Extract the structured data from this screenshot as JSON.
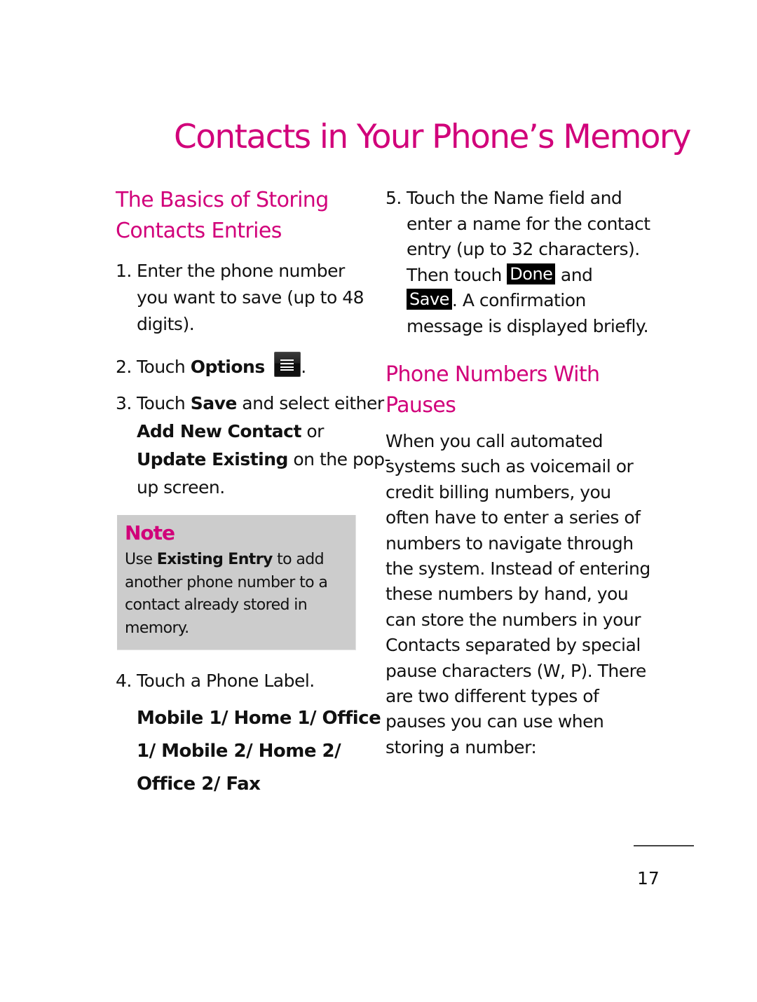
{
  "page_title": "Contacts in Your Phone’s Memory",
  "section1": {
    "heading_line1": "The Basics of Storing",
    "heading_line2": "Contacts Entries",
    "step1": {
      "number": "1.",
      "line1": "Enter the phone number",
      "line2": "you want to save (up to 48",
      "line3": "digits)."
    },
    "step2": {
      "number": "2.",
      "prefix": "Touch ",
      "bold": "Options",
      "suffix": ".",
      "icon": "options-menu-icon"
    },
    "step3": {
      "number": "3.",
      "prefix": "Touch ",
      "bold_save": "Save",
      "mid": " and select either",
      "bold_add": "Add New Contact",
      "or": " or",
      "bold_update": "Update Existing",
      "tail": " on the pop-",
      "line_last": "up screen."
    },
    "note": {
      "title": "Note",
      "prefix": "Use ",
      "bold": "Existing Entry",
      "line1_tail": " to add",
      "line2": "another phone number to a",
      "line3": "contact already stored in",
      "line4": "memory."
    },
    "step4": {
      "number": "4.",
      "text": "Touch a Phone Label.",
      "labels_line1": "Mobile 1/ Home 1/ Office",
      "labels_line2": "1/ Mobile 2/ Home 2/",
      "labels_line3": "Office 2/ Fax"
    }
  },
  "section2": {
    "step5": {
      "number": "5.",
      "line1": "Touch the Name field and",
      "line2": "enter a name for the contact",
      "line3": "entry (up to 32 characters).",
      "line4_prefix": "Then touch ",
      "done_chip": "Done",
      "line4_suffix": " and",
      "save_chip": "Save",
      "line5_suffix": ". A confirmation",
      "line6": "message is displayed briefly."
    },
    "heading_line1": "Phone Numbers With",
    "heading_line2": "Pauses",
    "paragraph_lines": [
      "When you call automated",
      "systems such as voicemail or",
      "credit billing numbers, you",
      "often have to enter a series of",
      "numbers to navigate through",
      "the system. Instead of entering",
      "these numbers by hand, you",
      "can store the numbers in your",
      "Contacts separated by special",
      "pause characters (W, P). There",
      "are two different types of",
      "pauses you can use when",
      "storing a number:"
    ]
  },
  "footer": {
    "page_number": "17"
  },
  "colors": {
    "accent": "#d1007a",
    "note_background": "#cccccc",
    "text": "#111111"
  }
}
